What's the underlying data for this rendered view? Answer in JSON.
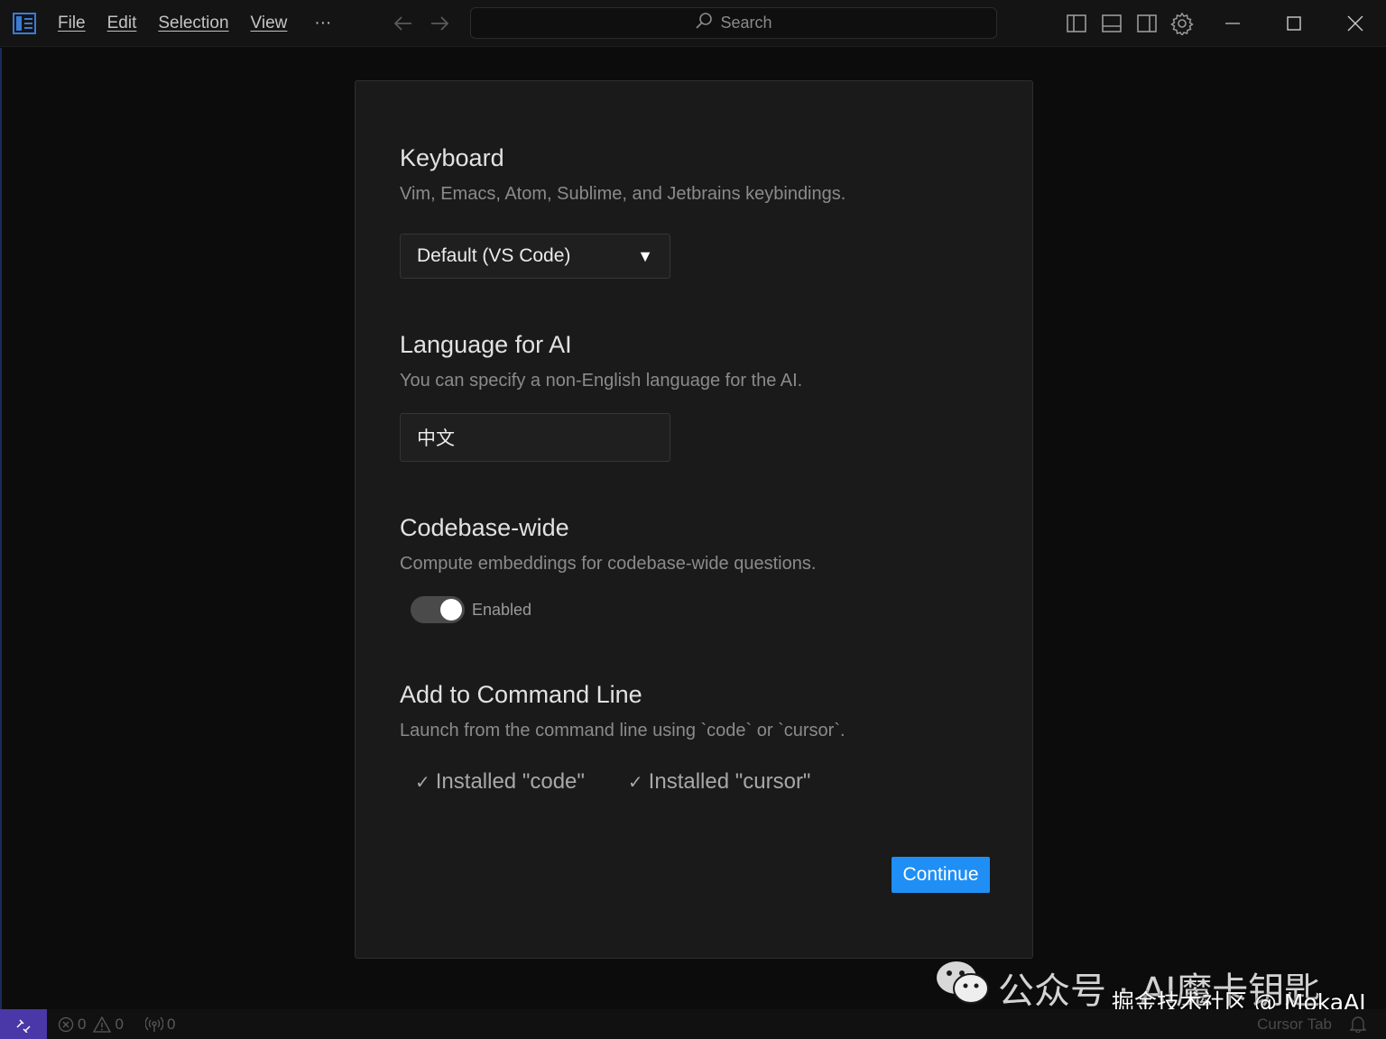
{
  "menu": {
    "file": "File",
    "edit": "Edit",
    "selection": "Selection",
    "view": "View",
    "more": "···"
  },
  "search": {
    "placeholder": "Search"
  },
  "icons": {
    "app": "cursor-app-icon",
    "back": "arrow-left-icon",
    "forward": "arrow-right-icon",
    "search": "search-icon",
    "toggle_primary_sidebar": "layout-sidebar-left-icon",
    "toggle_panel": "layout-panel-icon",
    "toggle_secondary_sidebar": "layout-sidebar-right-icon",
    "settings": "gear-icon",
    "minimize": "minimize-icon",
    "maximize": "maximize-icon",
    "close": "close-icon",
    "check": "check-icon",
    "remote": "remote-icon",
    "errors": "error-icon",
    "warnings": "warning-icon",
    "ports": "broadcast-icon",
    "bell": "bell-icon",
    "wechat": "wechat-icon"
  },
  "dialog": {
    "keyboard": {
      "title": "Keyboard",
      "description": "Vim, Emacs, Atom, Sublime, and Jetbrains keybindings.",
      "selected": "Default (VS Code)",
      "arrow": "▼"
    },
    "language": {
      "title": "Language for AI",
      "description": "You can specify a non-English language for the AI.",
      "value": "中文"
    },
    "codebase": {
      "title": "Codebase-wide",
      "description": "Compute embeddings for codebase-wide questions.",
      "toggle_label": "Enabled",
      "enabled": true
    },
    "command_line": {
      "title": "Add to Command Line",
      "description": "Launch from the command line using `code` or `cursor`.",
      "installed_code": "Installed \"code\"",
      "installed_cursor": "Installed \"cursor\"",
      "check_glyph": "✓"
    },
    "continue_label": "Continue"
  },
  "statusbar": {
    "errors": "0",
    "warnings": "0",
    "ports": "0",
    "right_label": "Cursor Tab"
  },
  "watermark": {
    "line1": "公众号 · AI魔卡钥匙",
    "line2": "掘金技术社区 @ MokaAI"
  },
  "colors": {
    "accent": "#1f8ff5",
    "remote": "#4a38a8",
    "dialog_bg": "#1a1a1a"
  }
}
